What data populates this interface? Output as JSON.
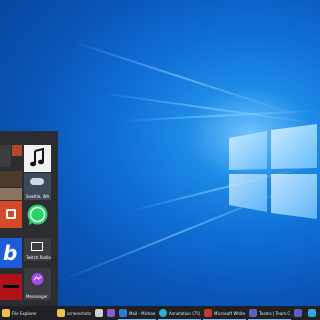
{
  "desktop": {
    "wallpaper_colors": {
      "light": "#6fc3ff",
      "mid": "#0f6fd6",
      "dark": "#063f94"
    }
  },
  "start_menu": {
    "tiles": [
      {
        "id": "tile-1",
        "label": "",
        "color": "#3a3c40"
      },
      {
        "id": "tile-2",
        "label": "",
        "color": "#b04a2a"
      },
      {
        "id": "groove-music",
        "label": "",
        "color": "#f2f2f2",
        "icon": "music-note-icon"
      },
      {
        "id": "news",
        "label": "",
        "color": "#4a3b2e"
      },
      {
        "id": "photos",
        "label": "",
        "color": "#8a7560"
      },
      {
        "id": "weather",
        "label": "Seattle, WA",
        "color": "#3c4a5a"
      },
      {
        "id": "office",
        "label": "",
        "color": "#d24a2a"
      },
      {
        "id": "whatsapp",
        "label": "",
        "color": "#2b2d31",
        "icon": "whatsapp-icon"
      },
      {
        "id": "bing",
        "label": "",
        "color": "#1d5bd8",
        "icon": "bing-icon"
      },
      {
        "id": "twitch",
        "label": "Twitch Radio",
        "color": "#3a3c40"
      },
      {
        "id": "netflix",
        "label": "",
        "color": "#b0121a"
      },
      {
        "id": "messenger",
        "label": "Messenger",
        "color": "#3a3c40",
        "icon": "messenger-icon"
      }
    ]
  },
  "taskbar": {
    "items": [
      {
        "id": "file-explorer",
        "label": "File Explorer",
        "color": "#f0c24a",
        "active": false
      },
      {
        "id": "screenshots",
        "label": "screenshots",
        "color": "#f0c24a",
        "active": false
      },
      {
        "id": "store",
        "label": "",
        "color": "#d0d0d0",
        "active": false
      },
      {
        "id": "visual-studio",
        "label": "",
        "color": "#8a5cd1",
        "active": false
      },
      {
        "id": "mail",
        "label": "Mail - Michael Mu...",
        "color": "#2f78d3",
        "active": true
      },
      {
        "id": "edge",
        "label": "Annotation (75) pro...",
        "color": "#2fb0c8",
        "active": true
      },
      {
        "id": "whiteboard",
        "label": "Microsoft Whiteboa...",
        "color": "#c0392b",
        "active": true
      },
      {
        "id": "teams",
        "label": "Teams | Team Cond...",
        "color": "#5a5fc7",
        "active": true
      },
      {
        "id": "music",
        "label": "",
        "color": "#5a5fc7",
        "active": false
      },
      {
        "id": "app-last",
        "label": "",
        "color": "#2fa7d8",
        "active": false
      }
    ]
  }
}
